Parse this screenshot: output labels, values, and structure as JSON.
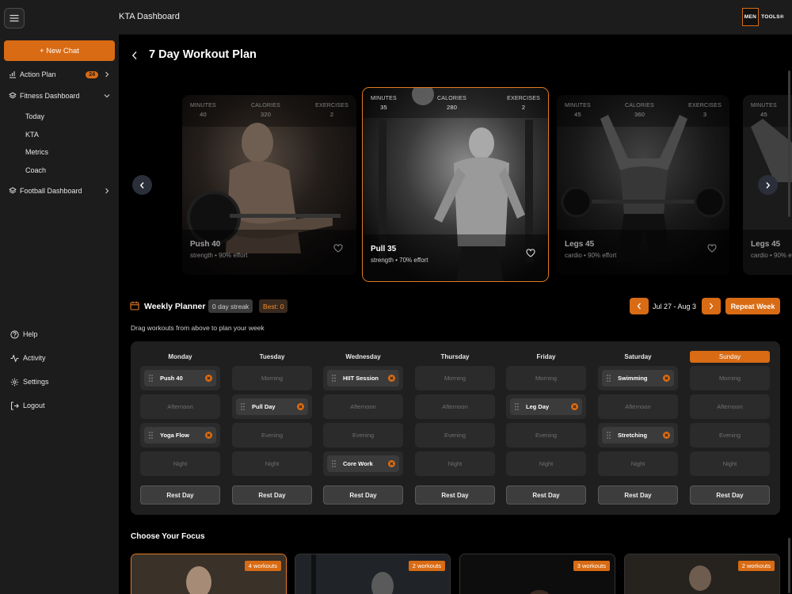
{
  "app": {
    "header_title": "KTA Dashboard",
    "logo_left": "MEN",
    "logo_right": "TOOLS®"
  },
  "sidebar": {
    "new_chat": "+ New Chat",
    "items": [
      {
        "label": "Action Plan",
        "badge": "24",
        "icon": "list-check-icon"
      },
      {
        "label": "Fitness Dashboard",
        "icon": "layers-icon",
        "expanded": true,
        "children": [
          "Today",
          "KTA",
          "Metrics",
          "Coach"
        ]
      },
      {
        "label": "Football Dashboard",
        "icon": "layers-icon"
      }
    ],
    "bottom": [
      {
        "label": "Help",
        "icon": "help-circle-icon"
      },
      {
        "label": "Activity",
        "icon": "activity-icon"
      },
      {
        "label": "Settings",
        "icon": "gear-icon"
      },
      {
        "label": "Logout",
        "icon": "logout-icon"
      }
    ]
  },
  "page": {
    "title": "7 Day Workout Plan"
  },
  "workouts": [
    {
      "name": "Push 40",
      "minutes": "40",
      "calories": "320",
      "exercises": "2",
      "type": "strength",
      "effort": "strength • 90% effort"
    },
    {
      "name": "Pull 35",
      "minutes": "35",
      "calories": "280",
      "exercises": "2",
      "type": "strength",
      "effort": "strength • 70% effort"
    },
    {
      "name": "Legs 45",
      "minutes": "45",
      "calories": "360",
      "exercises": "3",
      "type": "cardio",
      "effort": "cardio • 90% effort"
    },
    {
      "name": "Legs 45",
      "minutes": "45",
      "calories": "360",
      "exercises": "3",
      "type": "cardio",
      "effort": "cardio • 90% effort"
    }
  ],
  "stat_labels": {
    "minutes": "MINUTES",
    "calories": "CALORIES",
    "exercises": "EXERCISES"
  },
  "planner": {
    "title": "Weekly Planner",
    "streak": "0 day streak",
    "best": "Best: 0",
    "subtitle": "Drag workouts from above to plan your week",
    "range": "Jul 27 - Aug 3",
    "repeat": "Repeat Week",
    "rest_label": "Rest Day",
    "today": "Sunday",
    "days": [
      {
        "name": "Monday",
        "slots": [
          "Push 40",
          "Afternoon",
          "Yoga Flow",
          "Night"
        ]
      },
      {
        "name": "Tuesday",
        "slots": [
          "Morning",
          "Pull Day",
          "Evening",
          "Night"
        ]
      },
      {
        "name": "Wednesday",
        "slots": [
          "HIIT Session",
          "Afternoon",
          "Evening",
          "Core Work"
        ]
      },
      {
        "name": "Thursday",
        "slots": [
          "Morning",
          "Afternoon",
          "Evening",
          "Night"
        ]
      },
      {
        "name": "Friday",
        "slots": [
          "Morning",
          "Leg Day",
          "Evening",
          "Night"
        ]
      },
      {
        "name": "Saturday",
        "slots": [
          "Swimming",
          "Afternoon",
          "Stretching",
          "Night"
        ]
      },
      {
        "name": "Sunday",
        "slots": [
          "Morning",
          "Afternoon",
          "Evening",
          "Night"
        ]
      }
    ],
    "scheduled": {
      "Monday": [
        0,
        2
      ],
      "Tuesday": [
        1
      ],
      "Wednesday": [
        0,
        3
      ],
      "Friday": [
        1
      ],
      "Saturday": [
        0,
        2
      ]
    }
  },
  "focus": {
    "title": "Choose Your Focus",
    "cards": [
      {
        "badge": "4 workouts",
        "selected": true
      },
      {
        "badge": "2 workouts",
        "selected": false
      },
      {
        "badge": "3 workouts",
        "selected": false
      },
      {
        "badge": "2 workouts",
        "selected": false
      }
    ]
  },
  "colors": {
    "accent": "#d86b14",
    "panel": "#1f1f1f",
    "slot": "#2b2b2b"
  }
}
